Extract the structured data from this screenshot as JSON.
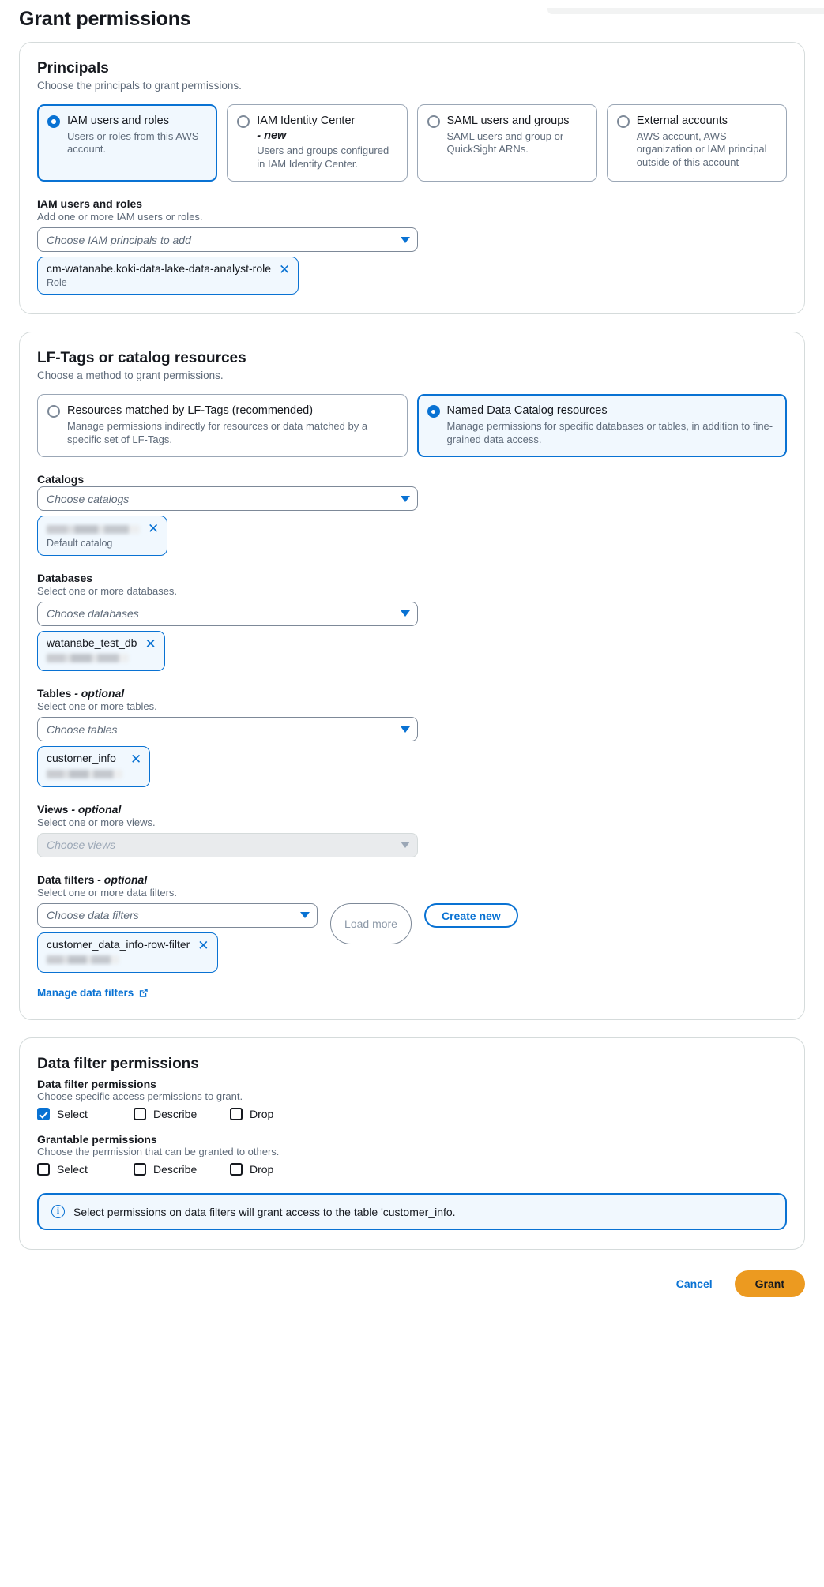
{
  "page": {
    "title": "Grant permissions"
  },
  "principals": {
    "heading": "Principals",
    "description": "Choose the principals to grant permissions.",
    "options": [
      {
        "label": "IAM users and roles",
        "description": "Users or roles from this AWS account.",
        "selected": true
      },
      {
        "label": "IAM Identity Center",
        "suffix": "- new",
        "description": "Users and groups configured in IAM Identity Center.",
        "selected": false
      },
      {
        "label": "SAML users and groups",
        "description": "SAML users and group or QuickSight ARNs.",
        "selected": false
      },
      {
        "label": "External accounts",
        "description": "AWS account, AWS organization or IAM principal outside of this account",
        "selected": false
      }
    ],
    "field": {
      "label": "IAM users and roles",
      "hint": "Add one or more IAM users or roles.",
      "placeholder": "Choose IAM principals to add",
      "chips": [
        {
          "main": "cm-watanabe.koki-data-lake-data-analyst-role",
          "sub": "Role",
          "sub_redacted": false
        }
      ]
    }
  },
  "resources": {
    "heading": "LF-Tags or catalog resources",
    "description": "Choose a method to grant permissions.",
    "options": [
      {
        "label": "Resources matched by LF-Tags (recommended)",
        "description": "Manage permissions indirectly for resources or data matched by a specific set of LF-Tags.",
        "selected": false
      },
      {
        "label": "Named Data Catalog resources",
        "description": "Manage permissions for specific databases or tables, in addition to fine-grained data access.",
        "selected": true
      }
    ],
    "catalogs": {
      "label": "Catalogs",
      "hint": "",
      "placeholder": "Choose catalogs",
      "chips": [
        {
          "main": "",
          "main_redacted": true,
          "sub": "Default catalog",
          "sub_redacted": false
        }
      ]
    },
    "databases": {
      "label": "Databases",
      "hint": "Select one or more databases.",
      "placeholder": "Choose databases",
      "chips": [
        {
          "main": "watanabe_test_db",
          "sub": "",
          "sub_redacted": true
        }
      ]
    },
    "tables": {
      "label": "Tables",
      "optional": "- optional",
      "hint": "Select one or more tables.",
      "placeholder": "Choose tables",
      "chips": [
        {
          "main": "customer_info",
          "sub": "",
          "sub_redacted": true
        }
      ]
    },
    "views": {
      "label": "Views",
      "optional": "- optional",
      "hint": "Select one or more views.",
      "placeholder": "Choose views",
      "disabled": true
    },
    "data_filters": {
      "label": "Data filters",
      "optional": "- optional",
      "hint": "Select one or more data filters.",
      "placeholder": "Choose data filters",
      "load_more_label": "Load more",
      "create_new_label": "Create new",
      "chips": [
        {
          "main": "customer_data_info-row-filter",
          "sub": "",
          "sub_redacted": true
        }
      ],
      "manage_link_label": "Manage data filters"
    }
  },
  "permissions": {
    "heading": "Data filter permissions",
    "data_filter": {
      "label": "Data filter permissions",
      "hint": "Choose specific access permissions to grant.",
      "items": [
        {
          "label": "Select",
          "checked": true
        },
        {
          "label": "Describe",
          "checked": false
        },
        {
          "label": "Drop",
          "checked": false
        }
      ]
    },
    "grantable": {
      "label": "Grantable permissions",
      "hint": "Choose the permission that can be granted to others.",
      "items": [
        {
          "label": "Select",
          "checked": false
        },
        {
          "label": "Describe",
          "checked": false
        },
        {
          "label": "Drop",
          "checked": false
        }
      ]
    },
    "alert": {
      "icon": "info-icon",
      "text": "Select permissions on data filters will grant access to the table 'customer_info."
    }
  },
  "footer": {
    "cancel_label": "Cancel",
    "grant_label": "Grant"
  },
  "colors": {
    "accent": "#0972d3",
    "tile_selected_bg": "#f1f8fe",
    "grant_button": "#ec9a20",
    "border": "#d5dbdb",
    "text_secondary": "#5f6b7a"
  }
}
